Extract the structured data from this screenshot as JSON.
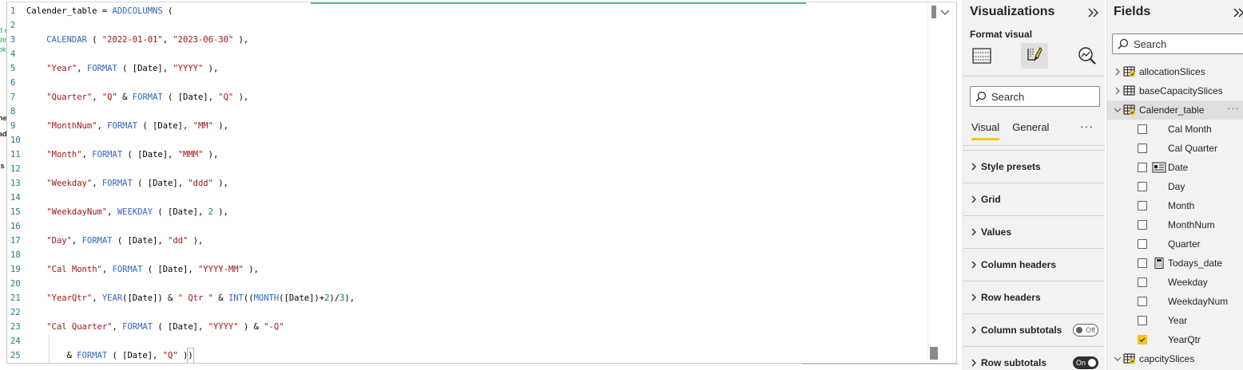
{
  "left_fragments": [
    {
      "text": "d e",
      "style": "green"
    },
    {
      "text": "etr",
      "style": "green"
    },
    {
      "text": "oke",
      "style": "green"
    },
    {
      "text": "ne",
      "style": "bold"
    },
    {
      "text": "ad",
      "style": "bold"
    },
    {
      "text": "is",
      "style": "bold"
    }
  ],
  "editor": {
    "lines": [
      {
        "n": "1",
        "tokens": [
          [
            "p",
            "Calender_table = "
          ],
          [
            "f",
            "ADDCOLUMNS"
          ],
          [
            "p",
            " ("
          ]
        ]
      },
      {
        "n": "2",
        "tokens": []
      },
      {
        "n": "3",
        "tokens": [
          [
            "p",
            "    "
          ],
          [
            "f",
            "CALENDAR"
          ],
          [
            "p",
            " ( "
          ],
          [
            "s",
            "\"2022-01-01\""
          ],
          [
            "p",
            ", "
          ],
          [
            "s",
            "\"2023-06-30\""
          ],
          [
            "p",
            " ),"
          ]
        ]
      },
      {
        "n": "4",
        "tokens": []
      },
      {
        "n": "5",
        "tokens": [
          [
            "p",
            "    "
          ],
          [
            "s",
            "\"Year\""
          ],
          [
            "p",
            ", "
          ],
          [
            "f",
            "FORMAT"
          ],
          [
            "p",
            " ( [Date], "
          ],
          [
            "s",
            "\"YYYY\""
          ],
          [
            "p",
            " ),"
          ]
        ]
      },
      {
        "n": "6",
        "tokens": []
      },
      {
        "n": "7",
        "tokens": [
          [
            "p",
            "    "
          ],
          [
            "s",
            "\"Quarter\""
          ],
          [
            "p",
            ", "
          ],
          [
            "s",
            "\"Q\""
          ],
          [
            "p",
            " & "
          ],
          [
            "f",
            "FORMAT"
          ],
          [
            "p",
            " ( [Date], "
          ],
          [
            "s",
            "\"Q\""
          ],
          [
            "p",
            " ),"
          ]
        ]
      },
      {
        "n": "8",
        "tokens": []
      },
      {
        "n": "9",
        "tokens": [
          [
            "p",
            "    "
          ],
          [
            "s",
            "\"MonthNum\""
          ],
          [
            "p",
            ", "
          ],
          [
            "f",
            "FORMAT"
          ],
          [
            "p",
            " ( [Date], "
          ],
          [
            "s",
            "\"MM\""
          ],
          [
            "p",
            " ),"
          ]
        ]
      },
      {
        "n": "10",
        "tokens": []
      },
      {
        "n": "11",
        "tokens": [
          [
            "p",
            "    "
          ],
          [
            "s",
            "\"Month\""
          ],
          [
            "p",
            ", "
          ],
          [
            "f",
            "FORMAT"
          ],
          [
            "p",
            " ( [Date], "
          ],
          [
            "s",
            "\"MMM\""
          ],
          [
            "p",
            " ),"
          ]
        ]
      },
      {
        "n": "12",
        "tokens": []
      },
      {
        "n": "13",
        "tokens": [
          [
            "p",
            "    "
          ],
          [
            "s",
            "\"Weekday\""
          ],
          [
            "p",
            ", "
          ],
          [
            "f",
            "FORMAT"
          ],
          [
            "p",
            " ( [Date], "
          ],
          [
            "s",
            "\"ddd\""
          ],
          [
            "p",
            " ),"
          ]
        ]
      },
      {
        "n": "14",
        "tokens": []
      },
      {
        "n": "15",
        "tokens": [
          [
            "p",
            "    "
          ],
          [
            "s",
            "\"WeekdayNum\""
          ],
          [
            "p",
            ", "
          ],
          [
            "f",
            "WEEKDAY"
          ],
          [
            "p",
            " ( [Date], "
          ],
          [
            "n",
            "2"
          ],
          [
            "p",
            " ),"
          ]
        ]
      },
      {
        "n": "16",
        "tokens": []
      },
      {
        "n": "17",
        "tokens": [
          [
            "p",
            "    "
          ],
          [
            "s",
            "\"Day\""
          ],
          [
            "p",
            ", "
          ],
          [
            "f",
            "FORMAT"
          ],
          [
            "p",
            " ( [Date], "
          ],
          [
            "s",
            "\"dd\""
          ],
          [
            "p",
            " ),"
          ]
        ]
      },
      {
        "n": "18",
        "tokens": []
      },
      {
        "n": "19",
        "tokens": [
          [
            "p",
            "    "
          ],
          [
            "s",
            "\"Cal Month\""
          ],
          [
            "p",
            ", "
          ],
          [
            "f",
            "FORMAT"
          ],
          [
            "p",
            " ( [Date], "
          ],
          [
            "s",
            "\"YYYY-MM\""
          ],
          [
            "p",
            " ),"
          ]
        ]
      },
      {
        "n": "20",
        "tokens": []
      },
      {
        "n": "21",
        "tokens": [
          [
            "p",
            "    "
          ],
          [
            "s",
            "\"YearQtr\""
          ],
          [
            "p",
            ", "
          ],
          [
            "f",
            "YEAR"
          ],
          [
            "p",
            "([Date]) & "
          ],
          [
            "s",
            "\" Qtr \""
          ],
          [
            "p",
            " & "
          ],
          [
            "f",
            "INT"
          ],
          [
            "p",
            "(("
          ],
          [
            "f",
            "MONTH"
          ],
          [
            "p",
            "([Date])+"
          ],
          [
            "n",
            "2"
          ],
          [
            "p",
            ")/"
          ],
          [
            "n",
            "3"
          ],
          [
            "p",
            "),"
          ]
        ]
      },
      {
        "n": "22",
        "tokens": []
      },
      {
        "n": "23",
        "tokens": [
          [
            "p",
            "    "
          ],
          [
            "s",
            "\"Cal Quarter\""
          ],
          [
            "p",
            ", "
          ],
          [
            "f",
            "FORMAT"
          ],
          [
            "p",
            " ( [Date], "
          ],
          [
            "s",
            "\"YYYY\""
          ],
          [
            "p",
            " ) & "
          ],
          [
            "s",
            "\"-Q\""
          ]
        ]
      },
      {
        "n": "24",
        "tokens": []
      },
      {
        "n": "25",
        "tokens": [
          [
            "p",
            "        & "
          ],
          [
            "f",
            "FORMAT"
          ],
          [
            "p",
            " ( [Date], "
          ],
          [
            "s",
            "\"Q\""
          ],
          [
            "p",
            " )"
          ],
          [
            "b",
            ")"
          ]
        ]
      }
    ]
  },
  "visualizations": {
    "title": "Visualizations",
    "format_visual_label": "Format visual",
    "search_placeholder": "Search",
    "tabs": [
      "Visual",
      "General"
    ],
    "more": "···",
    "sections": [
      {
        "label": "Style presets"
      },
      {
        "label": "Grid"
      },
      {
        "label": "Values"
      },
      {
        "label": "Column headers"
      },
      {
        "label": "Row headers"
      },
      {
        "label": "Column subtotals",
        "toggle": "Off"
      },
      {
        "label": "Row subtotals",
        "toggle": "On"
      }
    ]
  },
  "fields": {
    "title": "Fields",
    "search_placeholder": "Search",
    "tables": [
      {
        "name": "allocationSlices",
        "expanded": false,
        "check": true
      },
      {
        "name": "baseCapacitySlices",
        "expanded": false,
        "check": false
      },
      {
        "name": "Calender_table",
        "expanded": true,
        "check": true,
        "selected": true,
        "more": "···"
      }
    ],
    "calender_fields": [
      {
        "name": "Cal Month",
        "checked": false,
        "icon": ""
      },
      {
        "name": "Cal Quarter",
        "checked": false,
        "icon": ""
      },
      {
        "name": "Date",
        "checked": false,
        "icon": "date-hierarchy-icon"
      },
      {
        "name": "Day",
        "checked": false,
        "icon": ""
      },
      {
        "name": "Month",
        "checked": false,
        "icon": ""
      },
      {
        "name": "MonthNum",
        "checked": false,
        "icon": ""
      },
      {
        "name": "Quarter",
        "checked": false,
        "icon": ""
      },
      {
        "name": "Todays_date",
        "checked": false,
        "icon": "calculator-icon"
      },
      {
        "name": "Weekday",
        "checked": false,
        "icon": ""
      },
      {
        "name": "WeekdayNum",
        "checked": false,
        "icon": ""
      },
      {
        "name": "Year",
        "checked": false,
        "icon": ""
      },
      {
        "name": "YearQtr",
        "checked": true,
        "icon": ""
      }
    ],
    "last_table": {
      "name": "capcitySlices",
      "expanded": true,
      "check": true
    },
    "accent": "#f2c811"
  }
}
